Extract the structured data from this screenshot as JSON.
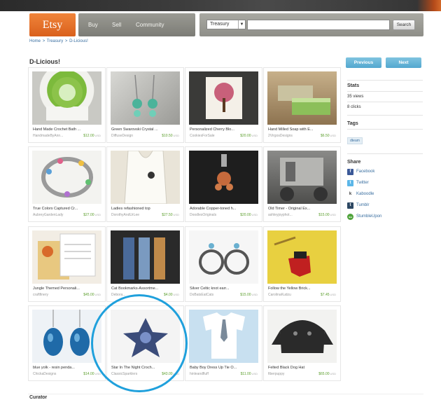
{
  "header": {
    "logo": "Etsy",
    "nav": [
      "Buy",
      "Sell",
      "Community"
    ],
    "search_scope": "Treasury",
    "search_button": "Search"
  },
  "breadcrumb": [
    "Home",
    ">",
    "Treasury",
    ">",
    "D-Licious!"
  ],
  "page_title": "D-Licious!",
  "buttons": {
    "previous": "Previous",
    "next": "Next"
  },
  "items": [
    {
      "title": "Hand Made Crochet Bath ...",
      "shop": "HandmadeByAnn...",
      "price": "$12.00",
      "currency": "USD"
    },
    {
      "title": "Green Swarovski Crystal ...",
      "shop": "DiffuseDesign",
      "price": "$10.50",
      "currency": "USD"
    },
    {
      "title": "Personalized Cherry Blo...",
      "shop": "CookiesForSale",
      "price": "$20.00",
      "currency": "USD"
    },
    {
      "title": "Hand Milled Soap with E...",
      "shop": "2VirgosDesigns",
      "price": "$6.50",
      "currency": "USD"
    },
    {
      "title": "True Colors Captured Cr...",
      "shop": "AubreyGardenLady",
      "price": "$27.00",
      "currency": "USD"
    },
    {
      "title": "Ladies refashioned top",
      "shop": "DorothyAndUrLee",
      "price": "$27.50",
      "currency": "USD"
    },
    {
      "title": "Adorable Copper-toned h...",
      "shop": "DoodlesOriginals",
      "price": "$20.00",
      "currency": "USD"
    },
    {
      "title": "Old Timer - Original Ex...",
      "shop": "ashleyjoyphot...",
      "price": "$15.00",
      "currency": "USD"
    },
    {
      "title": "Jungle Themed Personali...",
      "shop": "craftfinery",
      "price": "$45.00",
      "currency": "USD"
    },
    {
      "title": "Cat Bookmarks-Assortme...",
      "shop": "Debora...",
      "price": "$4.00",
      "currency": "USD"
    },
    {
      "title": "Silver Celtic knot earr...",
      "shop": "DoBatsEatCats",
      "price": "$15.00",
      "currency": "USD"
    },
    {
      "title": "Follow the Yellow Brick...",
      "shop": "CarolinaKudzu",
      "price": "$7.45",
      "currency": "USD"
    },
    {
      "title": "blue yolk - resin penda...",
      "shop": "ChickaDesigns",
      "price": "$14.00",
      "currency": "USD"
    },
    {
      "title": "Star In The Night Croch...",
      "shop": "ClassicSparklers",
      "price": "$43.00",
      "currency": "USD"
    },
    {
      "title": "Baby Boy Dress Up Tie O...",
      "shop": "hinleandfluff",
      "price": "$11.00",
      "currency": "USD"
    },
    {
      "title": "Felted Black Dog Hat",
      "shop": "fiberpuppy",
      "price": "$65.00",
      "currency": "USD"
    }
  ],
  "sidebar": {
    "stats_heading": "Stats",
    "views": "35 views",
    "clicks": "8 clicks",
    "tags_heading": "Tags",
    "tag": "dteam",
    "share_heading": "Share",
    "share": [
      {
        "label": "Facebook",
        "icon": "facebook-icon",
        "color": "#3b5998",
        "glyph": "f"
      },
      {
        "label": "Twitter",
        "icon": "twitter-icon",
        "color": "#5bb6e8",
        "glyph": "t"
      },
      {
        "label": "Kaboodle",
        "icon": "kaboodle-icon",
        "color": "#ffffff",
        "glyph": "k"
      },
      {
        "label": "Tumblr",
        "icon": "tumblr-icon",
        "color": "#2c4762",
        "glyph": "t"
      },
      {
        "label": "StumbleUpon",
        "icon": "stumbleupon-icon",
        "color": "#4fa33b",
        "glyph": "su"
      }
    ]
  },
  "footer": {
    "curator": "Curator"
  },
  "colors": {
    "accent": "#e5712a",
    "link": "#3a6fa0",
    "price": "#5b9e2c",
    "highlight_circle": "#1fa0dc"
  }
}
